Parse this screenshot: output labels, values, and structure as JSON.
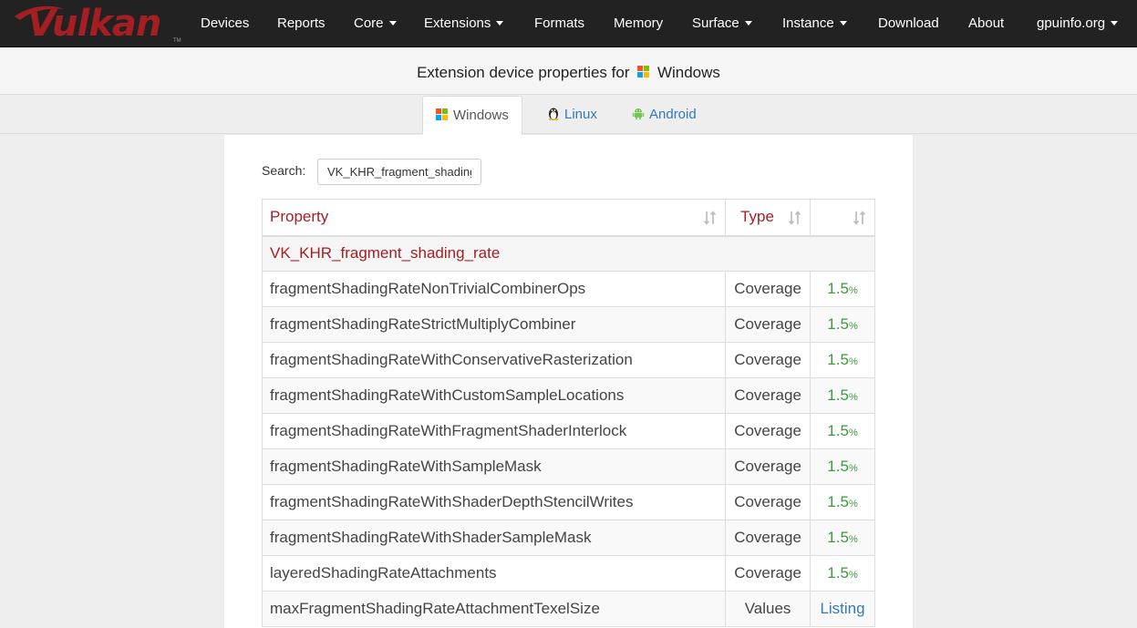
{
  "brand": {
    "logo_text": "Vulkan",
    "tm": "TM",
    "accent_color": "#a41e22"
  },
  "navbar": {
    "items": [
      {
        "label": "Devices",
        "dropdown": false
      },
      {
        "label": "Reports",
        "dropdown": false
      },
      {
        "label": "Core",
        "dropdown": true
      },
      {
        "label": "Extensions",
        "dropdown": true
      },
      {
        "label": "Formats",
        "dropdown": false
      },
      {
        "label": "Memory",
        "dropdown": false
      },
      {
        "label": "Surface",
        "dropdown": true
      },
      {
        "label": "Instance",
        "dropdown": true
      },
      {
        "label": "Download",
        "dropdown": false
      },
      {
        "label": "About",
        "dropdown": false
      },
      {
        "label": "gpuinfo.org",
        "dropdown": true
      }
    ]
  },
  "header": {
    "title_prefix": "Extension device properties for",
    "platform": "Windows",
    "platform_icon": "windows-logo-icon"
  },
  "tabs": [
    {
      "label": "Windows",
      "icon": "windows-logo-icon",
      "active": true
    },
    {
      "label": "Linux",
      "icon": "linux-penguin-icon",
      "active": false
    },
    {
      "label": "Android",
      "icon": "android-robot-icon",
      "active": false
    }
  ],
  "search": {
    "label": "Search:",
    "value": "VK_KHR_fragment_shading_rate"
  },
  "table": {
    "columns": [
      "Property",
      "Type",
      ""
    ],
    "group": "VK_KHR_fragment_shading_rate",
    "rows": [
      {
        "property": "fragmentShadingRateNonTrivialCombinerOps",
        "type": "Coverage",
        "value": "1.5",
        "unit": "%"
      },
      {
        "property": "fragmentShadingRateStrictMultiplyCombiner",
        "type": "Coverage",
        "value": "1.5",
        "unit": "%"
      },
      {
        "property": "fragmentShadingRateWithConservativeRasterization",
        "type": "Coverage",
        "value": "1.5",
        "unit": "%"
      },
      {
        "property": "fragmentShadingRateWithCustomSampleLocations",
        "type": "Coverage",
        "value": "1.5",
        "unit": "%"
      },
      {
        "property": "fragmentShadingRateWithFragmentShaderInterlock",
        "type": "Coverage",
        "value": "1.5",
        "unit": "%"
      },
      {
        "property": "fragmentShadingRateWithSampleMask",
        "type": "Coverage",
        "value": "1.5",
        "unit": "%"
      },
      {
        "property": "fragmentShadingRateWithShaderDepthStencilWrites",
        "type": "Coverage",
        "value": "1.5",
        "unit": "%"
      },
      {
        "property": "fragmentShadingRateWithShaderSampleMask",
        "type": "Coverage",
        "value": "1.5",
        "unit": "%"
      },
      {
        "property": "layeredShadingRateAttachments",
        "type": "Coverage",
        "value": "1.5",
        "unit": "%"
      },
      {
        "property": "maxFragmentShadingRateAttachmentTexelSize",
        "type": "Values",
        "value": "Listing",
        "unit": ""
      }
    ]
  },
  "colors": {
    "navbar_bg": "#222222",
    "coverage_green": "#3c9a3c",
    "link_blue": "#337ab7"
  }
}
